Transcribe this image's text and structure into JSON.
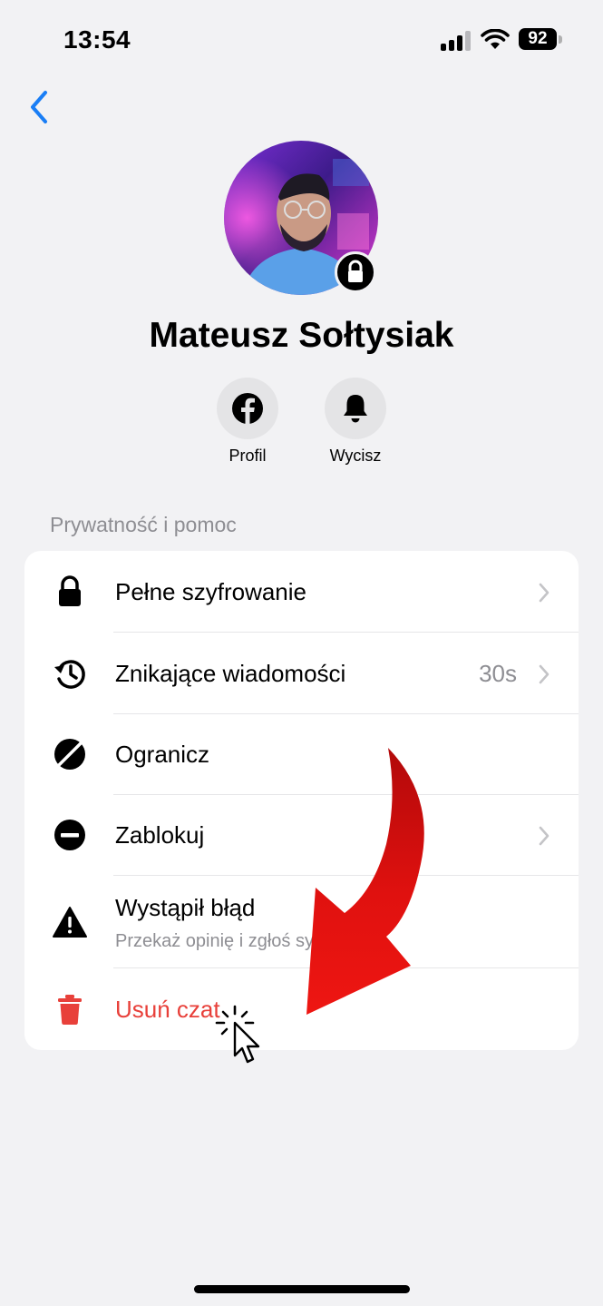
{
  "status_bar": {
    "time": "13:54",
    "battery": "92"
  },
  "profile": {
    "name": "Mateusz Sołtysiak"
  },
  "actions": [
    {
      "label": "Profil",
      "icon": "facebook-icon"
    },
    {
      "label": "Wycisz",
      "icon": "bell-icon"
    }
  ],
  "section": {
    "title": "Prywatność i pomoc",
    "rows": [
      {
        "label": "Pełne szyfrowanie",
        "icon": "lock-icon",
        "chevron": true
      },
      {
        "label": "Znikające wiadomości",
        "value": "30s",
        "icon": "clock-history-icon",
        "chevron": true
      },
      {
        "label": "Ogranicz",
        "icon": "restrict-icon",
        "chevron": false
      },
      {
        "label": "Zablokuj",
        "icon": "block-icon",
        "chevron": true
      },
      {
        "label": "Wystąpił błąd",
        "sublabel": "Przekaż opinię i zgłoś sytuację",
        "icon": "warning-icon",
        "chevron": false
      },
      {
        "label": "Usuń czat",
        "icon": "trash-icon",
        "chevron": false,
        "color": "#e8403a"
      }
    ]
  },
  "colors": {
    "accent": "#1a7ef5",
    "destructive": "#e8403a",
    "annotation_arrow": "#e0110f"
  }
}
